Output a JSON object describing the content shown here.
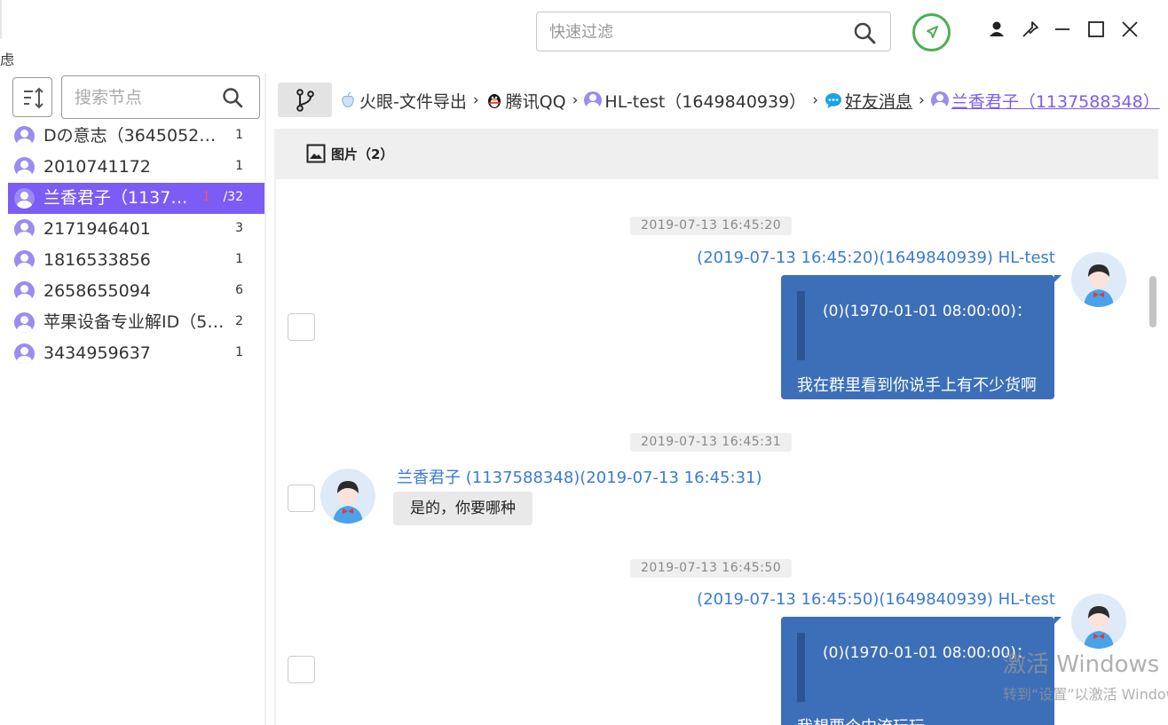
{
  "top_bar": {
    "left_fragment": "虑",
    "filter_placeholder": "快速过滤",
    "icons": [
      "search-icon",
      "rocket-icon",
      "user-icon",
      "pin-icon",
      "minimize-icon",
      "maximize-icon",
      "close-icon"
    ],
    "accent_color": "#4caf50"
  },
  "left_panel": {
    "search_placeholder": "搜索节点",
    "contacts": [
      {
        "name": "Dの意志（364505251…",
        "count": "1"
      },
      {
        "name": "2010741172",
        "count": "1"
      },
      {
        "name": "兰香君子（1137…",
        "unread": "1",
        "count": "/32",
        "selected": true
      },
      {
        "name": "2171946401",
        "count": "3"
      },
      {
        "name": "1816533856",
        "count": "1"
      },
      {
        "name": "2658655094",
        "count": "6"
      },
      {
        "name": "苹果设备专业解ID（5…",
        "count": "2"
      },
      {
        "name": "3434959637",
        "count": "1"
      }
    ],
    "selected_color": "#7b5cf5"
  },
  "breadcrumb": {
    "items": [
      {
        "label": "火眼-文件导出",
        "icon": "apple-icon"
      },
      {
        "label": "腾讯QQ",
        "icon": "qq-penguin-icon"
      },
      {
        "label": "HL-test（1649840939）",
        "icon": "person-icon"
      },
      {
        "label": "好友消息",
        "icon": "chat-bubble-icon"
      },
      {
        "label": "兰香君子（1137588348）",
        "icon": "person-icon"
      }
    ],
    "separator": "›"
  },
  "tabs": {
    "images_label": "图片（2）"
  },
  "messages": [
    {
      "timestamp": "2019-07-13 16:45:20",
      "sender": "(2019-07-13 16:45:20)(1649840939) HL-test",
      "direction": "outgoing",
      "quote": "(0)(1970-01-01 08:00:00)：",
      "text": "我在群里看到你说手上有不少货啊"
    },
    {
      "timestamp": "2019-07-13 16:45:31",
      "sender": "兰香君子 (1137588348)(2019-07-13 16:45:31)",
      "direction": "incoming",
      "text": "是的，你要哪种"
    },
    {
      "timestamp": "2019-07-13 16:45:50",
      "sender": "(2019-07-13 16:45:50)(1649840939) HL-test",
      "direction": "outgoing",
      "quote": "(0)(1970-01-01 08:00:00)：",
      "text": "我想要个中流玩玩"
    }
  ],
  "watermark": {
    "line1": "激活 Windows",
    "line2": "转到“设置”以激活 Windows。"
  }
}
